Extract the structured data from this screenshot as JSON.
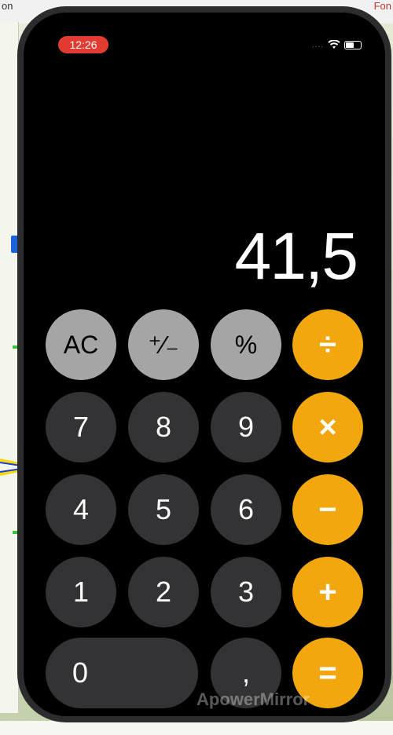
{
  "background": {
    "left_text": "on",
    "right_text": "Fon"
  },
  "status_bar": {
    "time": "12:26",
    "signal": "....",
    "wifi_icon": "wifi-icon",
    "battery_icon": "battery-icon"
  },
  "calculator": {
    "display": "41,5",
    "keys": {
      "ac": "AC",
      "plus_minus": "⁺∕₋",
      "percent": "%",
      "divide": "÷",
      "seven": "7",
      "eight": "8",
      "nine": "9",
      "multiply": "×",
      "four": "4",
      "five": "5",
      "six": "6",
      "minus": "−",
      "one": "1",
      "two": "2",
      "three": "3",
      "plus": "+",
      "zero": "0",
      "decimal": ",",
      "equals": "="
    }
  },
  "watermark": "ApowerMirror",
  "colors": {
    "operator": "#f1a70d",
    "function": "#a5a5a5",
    "number": "#333335",
    "time_badge": "#e23b32"
  }
}
